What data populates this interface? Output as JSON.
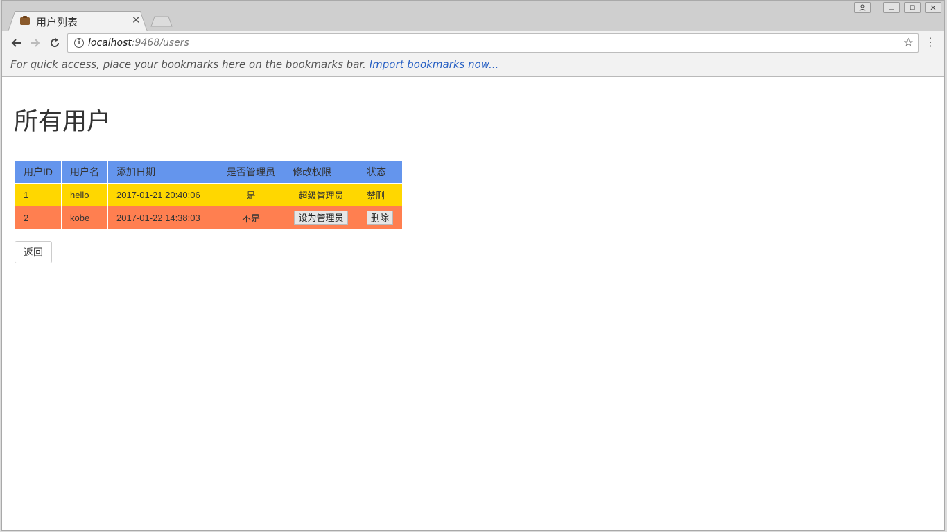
{
  "browser": {
    "tab_title": "用户列表",
    "tab_close": "✕",
    "url_host": "localhost",
    "url_rest": ":9468/users",
    "bookmarks_prompt": "For quick access, place your bookmarks here on the bookmarks bar.",
    "bookmarks_link": "Import bookmarks now..."
  },
  "page": {
    "title": "所有用户",
    "back_label": "返回"
  },
  "table": {
    "headers": [
      "用户ID",
      "用户名",
      "添加日期",
      "是否管理员",
      "修改权限",
      "状态"
    ],
    "rows": [
      {
        "id": "1",
        "name": "hello",
        "date": "2017-01-21 20:40:06",
        "is_admin": "是",
        "permission": "超级管理员",
        "status": "禁删",
        "color": "#ffd700"
      },
      {
        "id": "2",
        "name": "kobe",
        "date": "2017-01-22 14:38:03",
        "is_admin": "不是",
        "permission": "设为管理员",
        "status": "删除",
        "color": "#ff7f50"
      }
    ]
  },
  "colors": {
    "header_bg": "#6495ed",
    "link": "#2a62c4"
  }
}
